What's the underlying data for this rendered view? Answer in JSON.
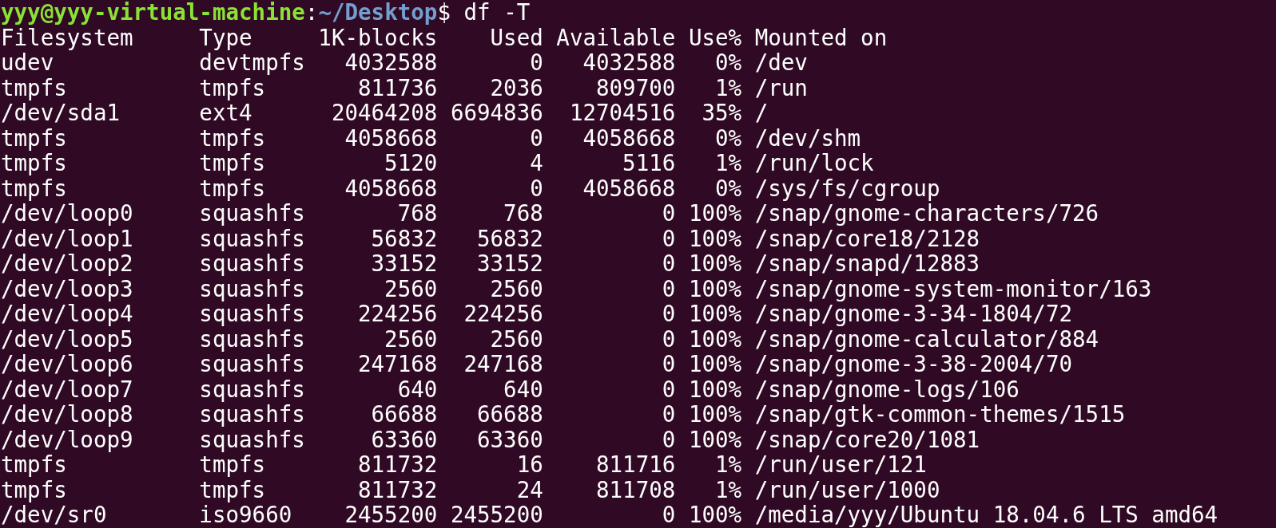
{
  "prompt": {
    "user_host": "yyy@yyy-virtual-machine",
    "separator": ":",
    "path": "~/Desktop",
    "symbol": "$",
    "command": "df -T"
  },
  "table": {
    "columns": [
      "Filesystem",
      "Type",
      "1K-blocks",
      "Used",
      "Available",
      "Use%",
      "Mounted on"
    ],
    "rows": [
      [
        "udev",
        "devtmpfs",
        "4032588",
        "0",
        "4032588",
        "0%",
        "/dev"
      ],
      [
        "tmpfs",
        "tmpfs",
        "811736",
        "2036",
        "809700",
        "1%",
        "/run"
      ],
      [
        "/dev/sda1",
        "ext4",
        "20464208",
        "6694836",
        "12704516",
        "35%",
        "/"
      ],
      [
        "tmpfs",
        "tmpfs",
        "4058668",
        "0",
        "4058668",
        "0%",
        "/dev/shm"
      ],
      [
        "tmpfs",
        "tmpfs",
        "5120",
        "4",
        "5116",
        "1%",
        "/run/lock"
      ],
      [
        "tmpfs",
        "tmpfs",
        "4058668",
        "0",
        "4058668",
        "0%",
        "/sys/fs/cgroup"
      ],
      [
        "/dev/loop0",
        "squashfs",
        "768",
        "768",
        "0",
        "100%",
        "/snap/gnome-characters/726"
      ],
      [
        "/dev/loop1",
        "squashfs",
        "56832",
        "56832",
        "0",
        "100%",
        "/snap/core18/2128"
      ],
      [
        "/dev/loop2",
        "squashfs",
        "33152",
        "33152",
        "0",
        "100%",
        "/snap/snapd/12883"
      ],
      [
        "/dev/loop3",
        "squashfs",
        "2560",
        "2560",
        "0",
        "100%",
        "/snap/gnome-system-monitor/163"
      ],
      [
        "/dev/loop4",
        "squashfs",
        "224256",
        "224256",
        "0",
        "100%",
        "/snap/gnome-3-34-1804/72"
      ],
      [
        "/dev/loop5",
        "squashfs",
        "2560",
        "2560",
        "0",
        "100%",
        "/snap/gnome-calculator/884"
      ],
      [
        "/dev/loop6",
        "squashfs",
        "247168",
        "247168",
        "0",
        "100%",
        "/snap/gnome-3-38-2004/70"
      ],
      [
        "/dev/loop7",
        "squashfs",
        "640",
        "640",
        "0",
        "100%",
        "/snap/gnome-logs/106"
      ],
      [
        "/dev/loop8",
        "squashfs",
        "66688",
        "66688",
        "0",
        "100%",
        "/snap/gtk-common-themes/1515"
      ],
      [
        "/dev/loop9",
        "squashfs",
        "63360",
        "63360",
        "0",
        "100%",
        "/snap/core20/1081"
      ],
      [
        "tmpfs",
        "tmpfs",
        "811732",
        "16",
        "811716",
        "1%",
        "/run/user/121"
      ],
      [
        "tmpfs",
        "tmpfs",
        "811732",
        "24",
        "811708",
        "1%",
        "/run/user/1000"
      ],
      [
        "/dev/sr0",
        "iso9660",
        "2455200",
        "2455200",
        "0",
        "100%",
        "/media/yyy/Ubuntu 18.04.6 LTS amd64"
      ]
    ]
  }
}
